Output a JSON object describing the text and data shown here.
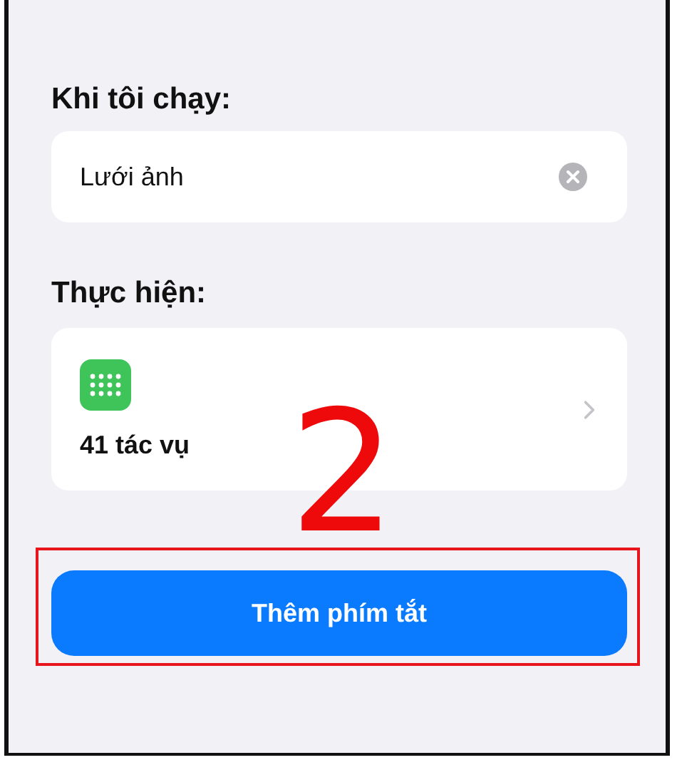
{
  "trigger": {
    "label": "Khi tôi chạy:",
    "value": "Lưới ảnh"
  },
  "action": {
    "label": "Thực hiện:",
    "summary": "41 tác vụ"
  },
  "primary_button": {
    "label": "Thêm phím tắt"
  },
  "annotation": {
    "step": "2"
  }
}
